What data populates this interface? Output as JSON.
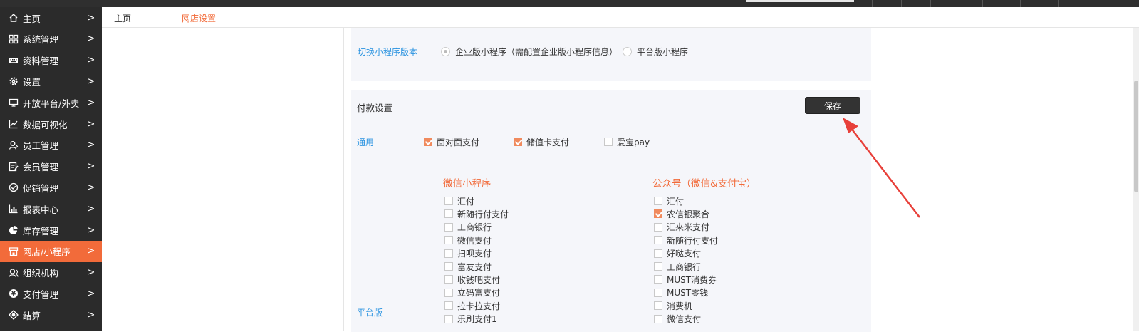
{
  "sidebar": {
    "items": [
      {
        "label": "主页",
        "icon": "home-icon"
      },
      {
        "label": "系统管理",
        "icon": "grid-icon"
      },
      {
        "label": "资料管理",
        "icon": "keyboard-icon"
      },
      {
        "label": "设置",
        "icon": "gear-icon"
      },
      {
        "label": "开放平台/外卖",
        "icon": "monitor-icon"
      },
      {
        "label": "数据可视化",
        "icon": "line-chart-icon"
      },
      {
        "label": "员工管理",
        "icon": "user-icon"
      },
      {
        "label": "会员管理",
        "icon": "member-card-icon"
      },
      {
        "label": "促销管理",
        "icon": "check-circle-icon"
      },
      {
        "label": "报表中心",
        "icon": "bar-chart-icon"
      },
      {
        "label": "库存管理",
        "icon": "pie-chart-icon"
      },
      {
        "label": "网店/小程序",
        "icon": "store-icon",
        "active": true
      },
      {
        "label": "组织机构",
        "icon": "org-icon"
      },
      {
        "label": "支付管理",
        "icon": "payment-icon"
      },
      {
        "label": "结算",
        "icon": "settle-icon"
      }
    ],
    "chevron": ">"
  },
  "breadcrumb": {
    "home": "主页",
    "current": "网店设置"
  },
  "version_section": {
    "label": "切换小程序版本",
    "options": [
      {
        "label": "企业版小程序（需配置企业版小程序信息）",
        "selected": true
      },
      {
        "label": "平台版小程序",
        "selected": false
      }
    ]
  },
  "payment": {
    "title": "付款设置",
    "save_label": "保存",
    "general": {
      "label": "通用",
      "options": [
        {
          "label": "面对面支付",
          "checked": true
        },
        {
          "label": "储值卡支付",
          "checked": true
        },
        {
          "label": "爱宝pay",
          "checked": false
        }
      ]
    },
    "platform_label": "平台版",
    "mini_program": {
      "title": "微信小程序",
      "options": [
        {
          "label": "汇付",
          "checked": false
        },
        {
          "label": "新随行付支付",
          "checked": false
        },
        {
          "label": "工商银行",
          "checked": false
        },
        {
          "label": "微信支付",
          "checked": false
        },
        {
          "label": "扫呗支付",
          "checked": false
        },
        {
          "label": "富友支付",
          "checked": false
        },
        {
          "label": "收钱吧支付",
          "checked": false
        },
        {
          "label": "立码富支付",
          "checked": false
        },
        {
          "label": "拉卡拉支付",
          "checked": false
        },
        {
          "label": "乐刷支付1",
          "checked": false
        }
      ]
    },
    "official_account": {
      "title": "公众号（微信&支付宝）",
      "options": [
        {
          "label": "汇付",
          "checked": false
        },
        {
          "label": "农信银聚合",
          "checked": true
        },
        {
          "label": "汇来米支付",
          "checked": false
        },
        {
          "label": "新随行付支付",
          "checked": false
        },
        {
          "label": "好哒支付",
          "checked": false
        },
        {
          "label": "工商银行",
          "checked": false
        },
        {
          "label": "MUST消费券",
          "checked": false
        },
        {
          "label": "MUST零钱",
          "checked": false
        },
        {
          "label": "消费机",
          "checked": false
        },
        {
          "label": "微信支付",
          "checked": false
        }
      ]
    }
  },
  "colors": {
    "accent": "#f26b3a",
    "sidebar_bg": "#2b2b2b",
    "label_blue": "#2a93e0",
    "arrow_red": "#e8403a"
  }
}
